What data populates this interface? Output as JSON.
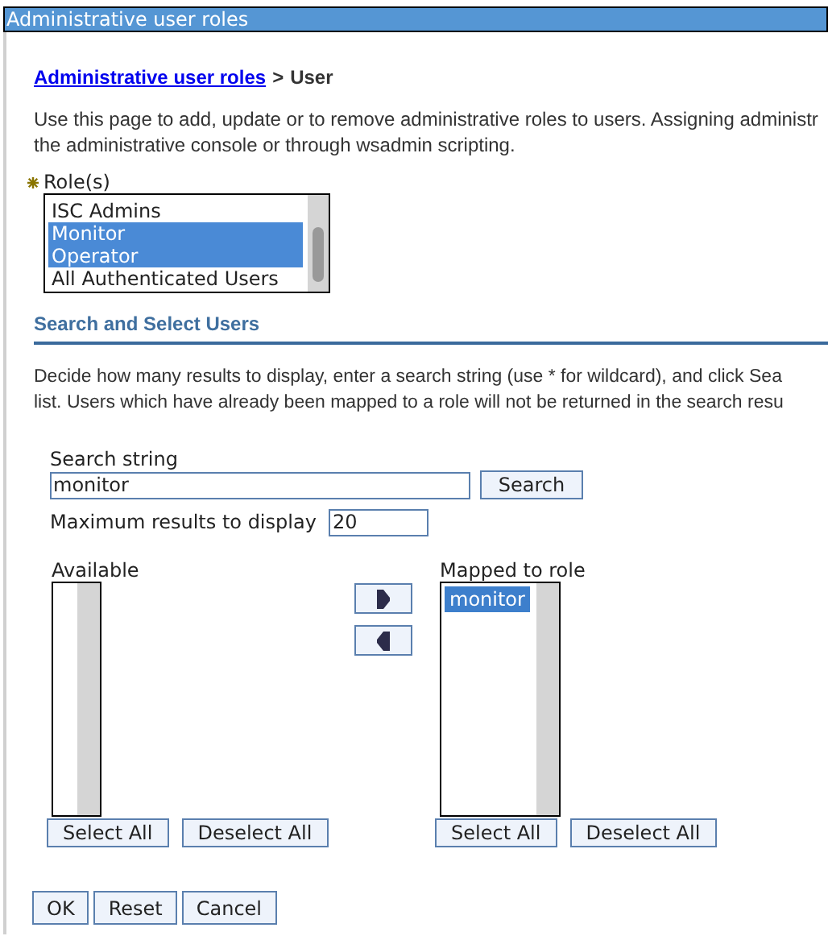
{
  "window": {
    "title": "Administrative user roles"
  },
  "breadcrumb": {
    "link": "Administrative user roles",
    "separator": ">",
    "current": "User"
  },
  "description": [
    "Use this page to add, update or to remove administrative roles to users. Assigning administr",
    "the administrative console or through wsadmin scripting."
  ],
  "roles": {
    "label": "Role(s)",
    "required": true,
    "items": [
      {
        "label": "ISC Admins",
        "selected": false
      },
      {
        "label": "Monitor",
        "selected": true
      },
      {
        "label": "Operator",
        "selected": true
      },
      {
        "label": "All Authenticated Users",
        "selected": false
      }
    ]
  },
  "section": {
    "title": "Search and Select Users",
    "description": [
      "Decide how many results to display, enter a search string (use * for wildcard), and click Sea",
      "list. Users which have already been mapped to a role will not be returned in the search resu"
    ]
  },
  "search": {
    "label": "Search string",
    "value": "monitor",
    "button": "Search"
  },
  "max_results": {
    "label": "Maximum results to display",
    "value": "20"
  },
  "available": {
    "label": "Available",
    "buttons": [
      "Select All",
      "Deselect All"
    ]
  },
  "mapped": {
    "label": "Mapped to role",
    "items": [
      {
        "label": "monitor",
        "selected": true
      }
    ],
    "buttons": [
      "Select All",
      "Deselect All"
    ]
  },
  "actions": [
    "OK",
    "Reset",
    "Cancel"
  ]
}
